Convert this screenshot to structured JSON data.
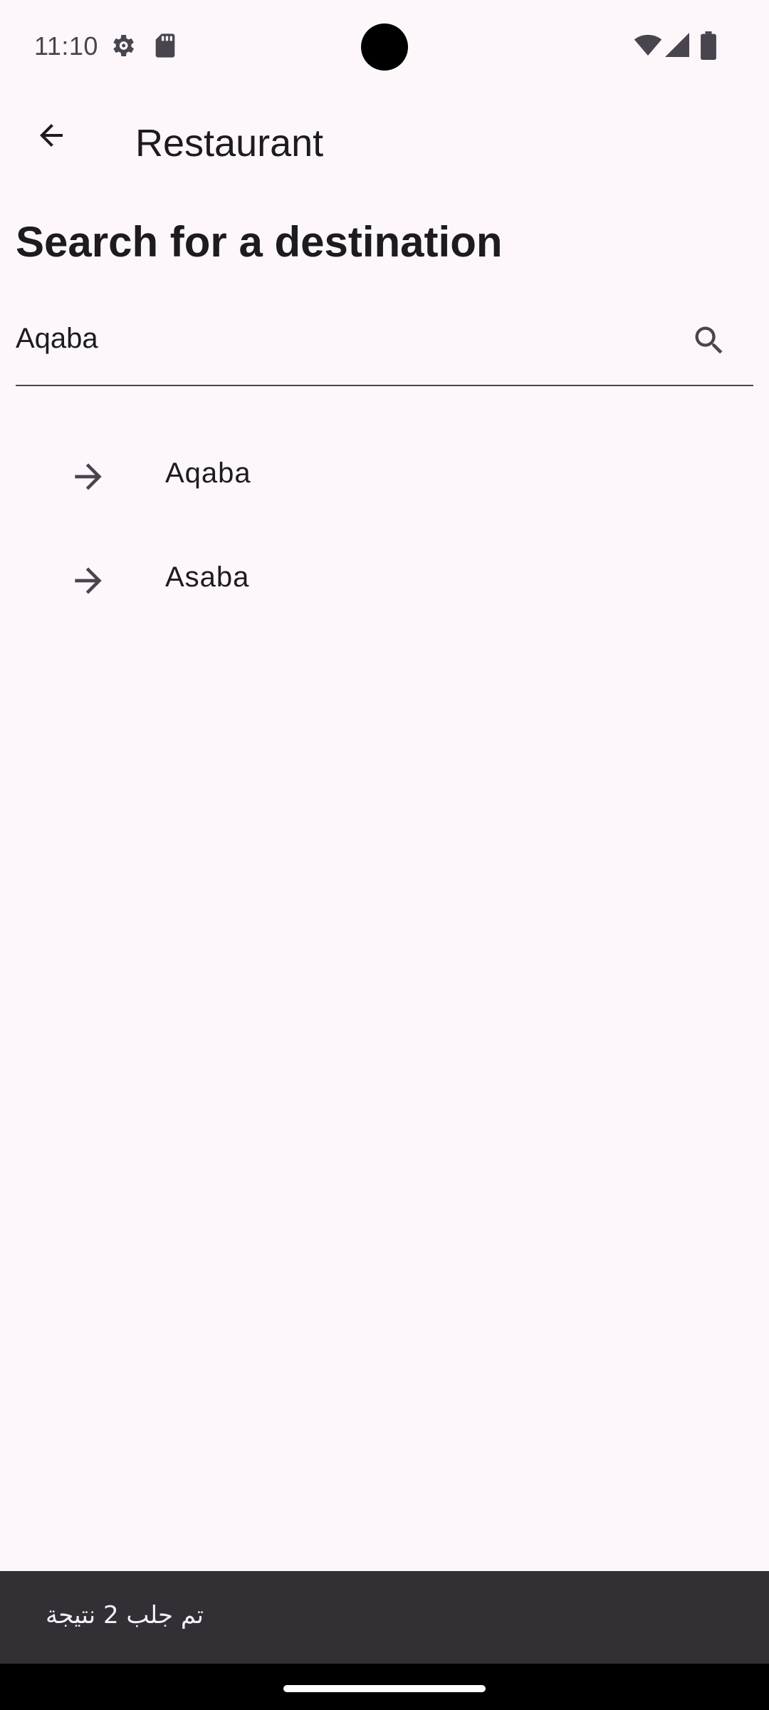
{
  "status_bar": {
    "time": "11:10",
    "left_icons": [
      "settings-gear-icon",
      "sd-card-icon"
    ],
    "right_icons": [
      "wifi-icon",
      "cell-signal-icon",
      "battery-icon"
    ]
  },
  "app_bar": {
    "back_icon": "arrow-back-icon",
    "title": "Restaurant"
  },
  "heading": "Search for a destination",
  "search": {
    "value": "Aqaba",
    "icon": "search-icon"
  },
  "results": [
    {
      "label": "Aqaba",
      "icon": "arrow-forward-icon"
    },
    {
      "label": "Asaba",
      "icon": "arrow-forward-icon"
    }
  ],
  "snackbar": {
    "message": "تم جلب 2 نتيجة"
  },
  "colors": {
    "background": "#FDF7FC",
    "on_surface": "#1D1B20",
    "on_surface_variant": "#49454F",
    "snackbar_bg": "#322F35",
    "snackbar_text": "#F5EFF7"
  }
}
